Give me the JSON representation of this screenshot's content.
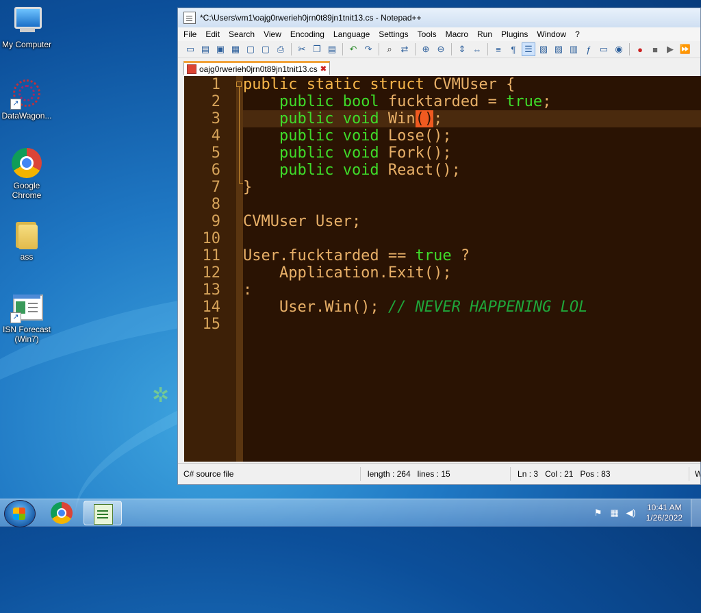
{
  "desktop": {
    "icons": [
      {
        "label": "My Computer",
        "icon": "computer-icon"
      },
      {
        "label": "DataWagon...",
        "icon": "network-web-icon"
      },
      {
        "label": "Google Chrome",
        "icon": "chrome-icon"
      },
      {
        "label": "ass",
        "icon": "folder-icon"
      },
      {
        "label": "ISN Forecast (Win7)",
        "icon": "application-window-icon"
      }
    ]
  },
  "window": {
    "title": "*C:\\Users\\vm1\\oajg0rwerieh0jrn0t89jn1tnit13.cs - Notepad++",
    "menu": [
      "File",
      "Edit",
      "Search",
      "View",
      "Encoding",
      "Language",
      "Settings",
      "Tools",
      "Macro",
      "Run",
      "Plugins",
      "Window",
      "?"
    ],
    "tab": {
      "label": "oajg0rwerieh0jrn0t89jn1tnit13.cs",
      "close": "✖"
    }
  },
  "editor": {
    "line_numbers": [
      "1",
      "2",
      "3",
      "4",
      "5",
      "6",
      "7",
      "8",
      "9",
      "10",
      "11",
      "12",
      "13",
      "14",
      "15"
    ],
    "current_line": 3,
    "colors": {
      "background": "#2a1303",
      "keyword": "#f7b64a",
      "keyword_type": "#3fdc2a",
      "comment": "#1fa63a",
      "gutter": "#3d2007"
    }
  },
  "status": {
    "language": "C# source file",
    "length": "length : 264",
    "lines": "lines : 15",
    "ln": "Ln : 3",
    "col": "Col : 21",
    "pos": "Pos : 83",
    "extra": "W"
  },
  "taskbar": {
    "time": "10:41 AM",
    "date": "1/26/2022"
  }
}
